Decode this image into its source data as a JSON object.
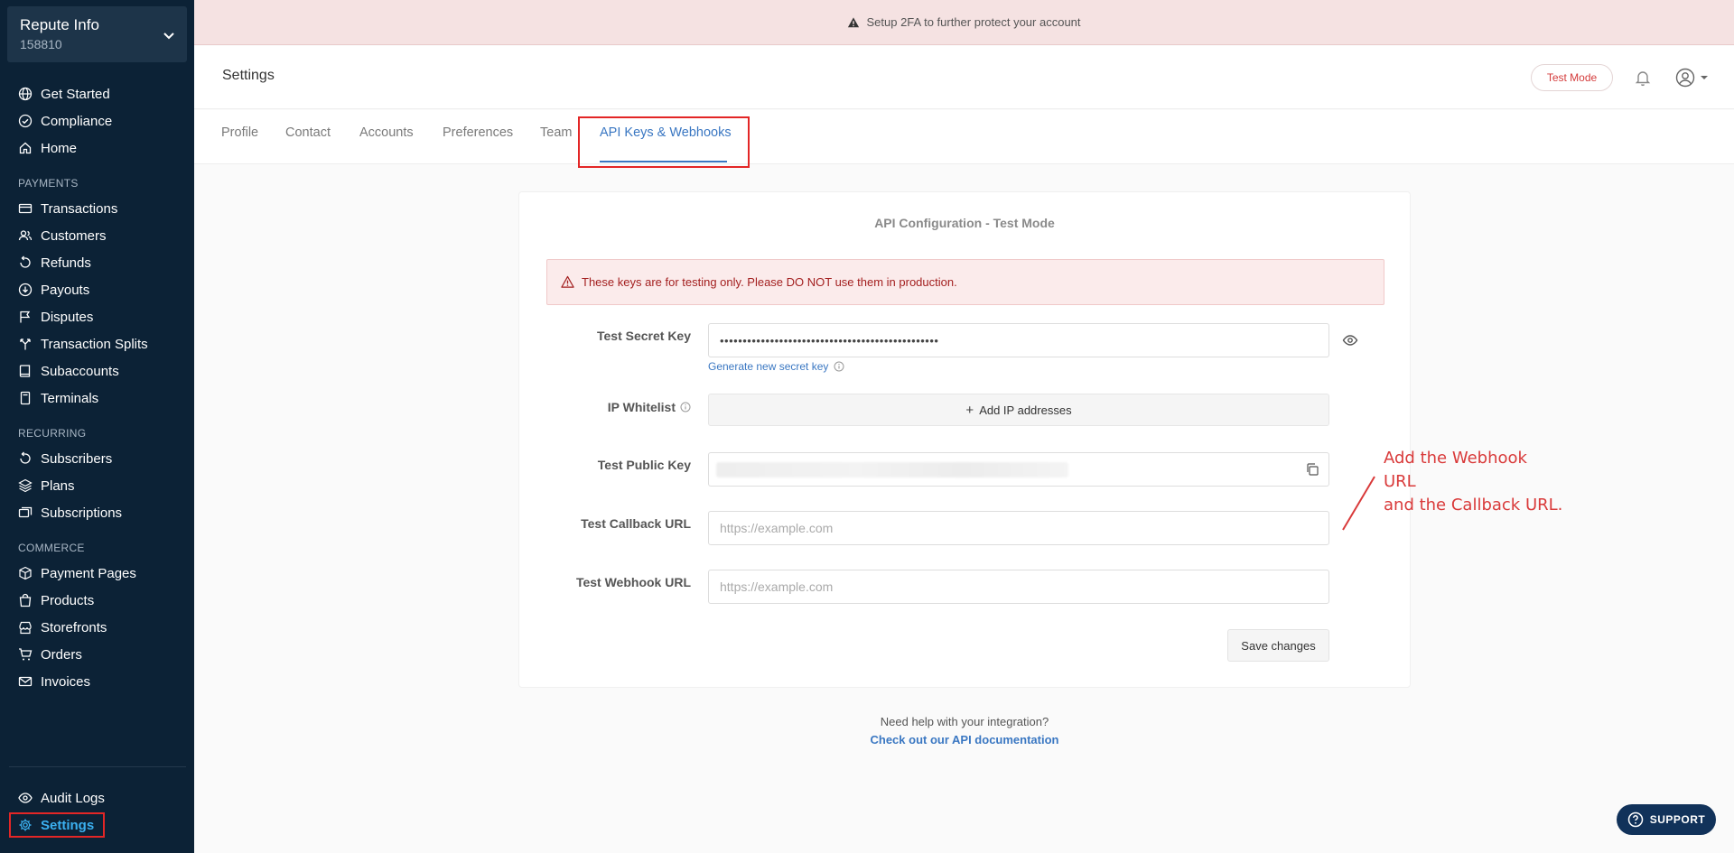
{
  "sidebar": {
    "business": {
      "name": "Repute Info",
      "id": "158810"
    },
    "top_items": [
      {
        "label": "Get Started"
      },
      {
        "label": "Compliance"
      },
      {
        "label": "Home"
      }
    ],
    "sections": [
      {
        "title": "PAYMENTS",
        "items": [
          {
            "label": "Transactions"
          },
          {
            "label": "Customers"
          },
          {
            "label": "Refunds"
          },
          {
            "label": "Payouts"
          },
          {
            "label": "Disputes"
          },
          {
            "label": "Transaction Splits"
          },
          {
            "label": "Subaccounts"
          },
          {
            "label": "Terminals"
          }
        ]
      },
      {
        "title": "RECURRING",
        "items": [
          {
            "label": "Subscribers"
          },
          {
            "label": "Plans"
          },
          {
            "label": "Subscriptions"
          }
        ]
      },
      {
        "title": "COMMERCE",
        "items": [
          {
            "label": "Payment Pages"
          },
          {
            "label": "Products"
          },
          {
            "label": "Storefronts"
          },
          {
            "label": "Orders"
          },
          {
            "label": "Invoices"
          }
        ]
      }
    ],
    "bottom_items": [
      {
        "label": "Audit Logs"
      },
      {
        "label": "Settings"
      }
    ],
    "active_color": "#3bb0f0"
  },
  "banner": {
    "text": "Setup 2FA to further protect your account"
  },
  "header": {
    "title": "Settings",
    "test_mode_label": "Test Mode"
  },
  "tabs": [
    {
      "label": "Profile"
    },
    {
      "label": "Contact"
    },
    {
      "label": "Accounts"
    },
    {
      "label": "Preferences"
    },
    {
      "label": "Team"
    },
    {
      "label": "API Keys & Webhooks"
    }
  ],
  "api_config": {
    "title": "API Configuration - Test Mode",
    "warning": "These keys are for testing only. Please DO NOT use them in production.",
    "secret_key": {
      "label": "Test Secret Key",
      "value": "••••••••••••••••••••••••••••••••••••••••••••••••",
      "generate_link": "Generate new secret key"
    },
    "ip_whitelist": {
      "label": "IP Whitelist",
      "button": "Add IP addresses"
    },
    "public_key": {
      "label": "Test Public Key"
    },
    "callback_url": {
      "label": "Test Callback URL",
      "placeholder": "https://example.com"
    },
    "webhook_url": {
      "label": "Test Webhook URL",
      "placeholder": "https://example.com"
    },
    "save_label": "Save changes"
  },
  "annotation": {
    "line1": "Add the Webhook URL",
    "line2": "and the Callback URL."
  },
  "help": {
    "text": "Need help with your integration?",
    "link": "Check out our API documentation"
  },
  "support": {
    "label": "SUPPORT"
  }
}
